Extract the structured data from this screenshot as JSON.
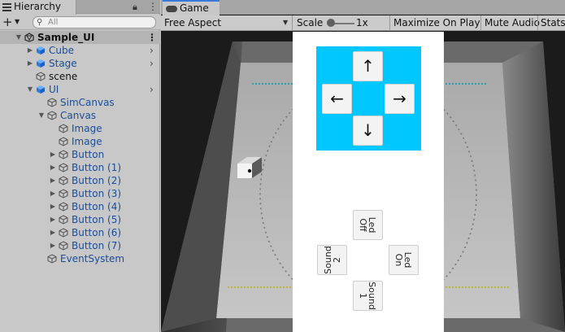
{
  "hierarchy": {
    "tab_label": "Hierarchy",
    "search_placeholder": "All",
    "rows": [
      {
        "label": "Sample_UI",
        "style": "bold",
        "icon": "unity-scene-icon",
        "arrow": "down"
      },
      {
        "label": "Cube",
        "style": "blue",
        "icon": "prefab-cube-icon",
        "arrow": "right",
        "chev": true
      },
      {
        "label": "Stage",
        "style": "blue",
        "icon": "prefab-cube-icon",
        "arrow": "right",
        "chev": true
      },
      {
        "label": "scene",
        "style": "black",
        "icon": "gameobject-cube-icon",
        "arrow": ""
      },
      {
        "label": "UI",
        "style": "blue",
        "icon": "prefab-cube-icon",
        "arrow": "down",
        "chev": true
      },
      {
        "label": "SimCanvas",
        "style": "blue",
        "icon": "gameobject-cube-icon",
        "arrow": ""
      },
      {
        "label": "Canvas",
        "style": "blue",
        "icon": "gameobject-cube-icon",
        "arrow": "down"
      },
      {
        "label": "Image",
        "style": "blue",
        "icon": "gameobject-cube-icon",
        "arrow": ""
      },
      {
        "label": "Image",
        "style": "blue",
        "icon": "gameobject-cube-icon",
        "arrow": ""
      },
      {
        "label": "Button",
        "style": "blue",
        "icon": "gameobject-cube-icon",
        "arrow": "right"
      },
      {
        "label": "Button (1)",
        "style": "blue",
        "icon": "gameobject-cube-icon",
        "arrow": "right"
      },
      {
        "label": "Button (2)",
        "style": "blue",
        "icon": "gameobject-cube-icon",
        "arrow": "right"
      },
      {
        "label": "Button (3)",
        "style": "blue",
        "icon": "gameobject-cube-icon",
        "arrow": "right"
      },
      {
        "label": "Button (4)",
        "style": "blue",
        "icon": "gameobject-cube-icon",
        "arrow": "right"
      },
      {
        "label": "Button (5)",
        "style": "blue",
        "icon": "gameobject-cube-icon",
        "arrow": "right"
      },
      {
        "label": "Button (6)",
        "style": "blue",
        "icon": "gameobject-cube-icon",
        "arrow": "right"
      },
      {
        "label": "Button (7)",
        "style": "blue",
        "icon": "gameobject-cube-icon",
        "arrow": "right"
      },
      {
        "label": "EventSystem",
        "style": "blue",
        "icon": "gameobject-cube-icon",
        "arrow": ""
      }
    ]
  },
  "game": {
    "tab_label": "Game",
    "toolbar": {
      "aspect": "Free Aspect",
      "scale_label": "Scale",
      "scale_value": "1x",
      "maximize": "Maximize On Play",
      "mute": "Mute Audio",
      "stats": "Stats"
    },
    "dpad": {
      "up": "↑",
      "left": "←",
      "right": "→",
      "down": "↓",
      "color": "#00c8ff"
    },
    "buttons": {
      "led_off_1": "Led",
      "led_off_2": "Off",
      "sound2_1": "Sound",
      "sound2_2": "2",
      "led_on_1": "Led",
      "led_on_2": "On",
      "sound1_1": "Sound",
      "sound1_2": "1"
    }
  }
}
